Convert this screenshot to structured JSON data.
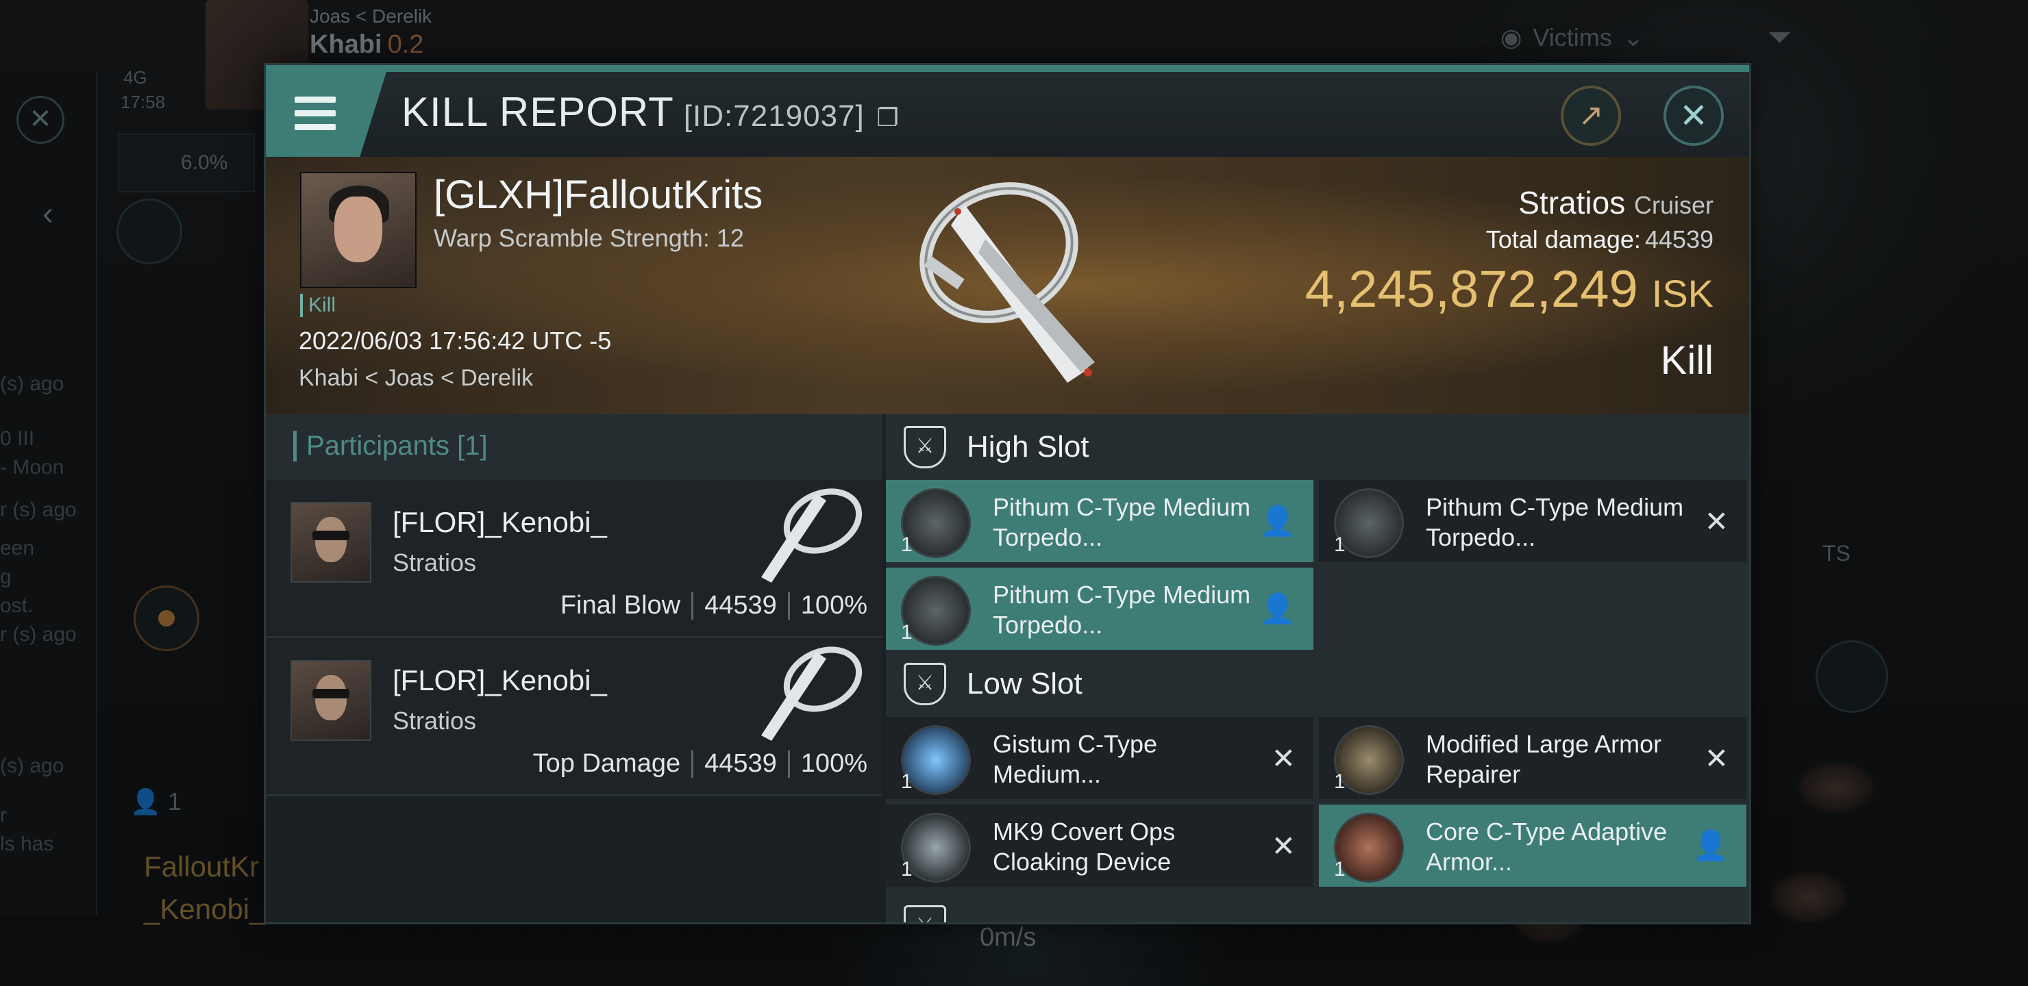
{
  "hud": {
    "location_path": "Joas  < Derelik",
    "system_name": "Khabi",
    "security": "0.2",
    "signal": "4G",
    "clock": "17:58",
    "zoom": "6.0%",
    "people_count": "1",
    "bottom_names": [
      "FalloutKr",
      "_Kenobi_"
    ],
    "speed": "0m/s",
    "filter_label": "Victims",
    "left_texts": [
      "(s) ago",
      "0 III",
      "- Moon",
      "r (s) ago",
      "een",
      "g",
      "ost.",
      "r (s) ago",
      "(s) ago",
      "r",
      "ls has"
    ],
    "right_text": "TS"
  },
  "modal": {
    "title": "KILL REPORT",
    "id": "[ID:7219037]",
    "victim": {
      "name": "[GLXH]FalloutKrits",
      "warp_scramble": "Warp Scramble Strength: 12",
      "kill_tag": "Kill",
      "datetime": "2022/06/03 17:56:42 UTC -5",
      "location": "Khabi < Joas < Derelik"
    },
    "ship": {
      "name": "Stratios",
      "class": "Cruiser",
      "total_damage_label": "Total damage:",
      "total_damage": "44539",
      "isk_value": "4,245,872,249",
      "isk_unit": "ISK",
      "result": "Kill"
    },
    "participants": {
      "title": "Participants",
      "count": "[1]",
      "rows": [
        {
          "name": "[FLOR]_Kenobi_",
          "ship": "Stratios",
          "role": "Final Blow",
          "damage": "44539",
          "percent": "100%"
        },
        {
          "name": "[FLOR]_Kenobi_",
          "ship": "Stratios",
          "role": "Top Damage",
          "damage": "44539",
          "percent": "100%"
        }
      ]
    },
    "high_slot": {
      "label": "High Slot",
      "modules": [
        {
          "name": "Pithum C-Type Medium Torpedo...",
          "qty": "1",
          "status": "dropped",
          "status_icon": "person-icon"
        },
        {
          "name": "Pithum C-Type Medium Torpedo...",
          "qty": "1",
          "status": "destroyed",
          "status_icon": "x-icon"
        },
        {
          "name": "Pithum C-Type Medium Torpedo...",
          "qty": "1",
          "status": "dropped",
          "status_icon": "person-icon"
        }
      ]
    },
    "low_slot": {
      "label": "Low Slot",
      "modules": [
        {
          "name": "Gistum C-Type Medium...",
          "qty": "1",
          "status": "destroyed",
          "status_icon": "x-icon"
        },
        {
          "name": "Modified Large Armor Repairer",
          "qty": "1",
          "status": "destroyed",
          "status_icon": "x-icon"
        },
        {
          "name": "MK9 Covert Ops Cloaking Device",
          "qty": "1",
          "status": "destroyed",
          "status_icon": "x-icon"
        },
        {
          "name": "Core C-Type Adaptive Armor...",
          "qty": "1",
          "status": "dropped",
          "status_icon": "person-icon"
        }
      ]
    }
  },
  "colors": {
    "accent_teal": "#3e7c76",
    "isk_gold": "#e6c071",
    "panel_dark": "#1b2024"
  }
}
